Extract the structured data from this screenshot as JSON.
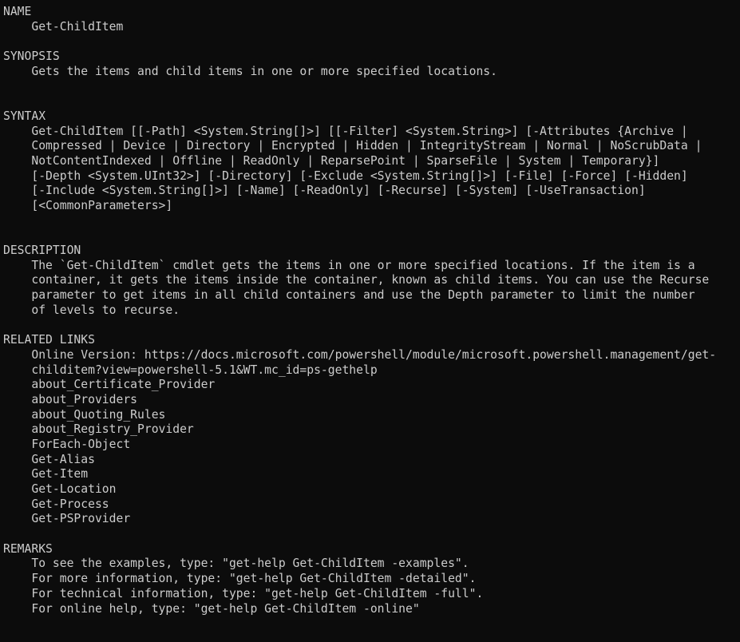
{
  "terminal": {
    "app": "powershell-help-output",
    "background_color": "#0c0c0c",
    "foreground_color": "#cccccc",
    "command_context": "Get-Help Get-ChildItem",
    "lines": [
      "NAME",
      "    Get-ChildItem",
      "",
      "SYNOPSIS",
      "    Gets the items and child items in one or more specified locations.",
      "",
      "",
      "SYNTAX",
      "    Get-ChildItem [[-Path] <System.String[]>] [[-Filter] <System.String>] [-Attributes {Archive |",
      "    Compressed | Device | Directory | Encrypted | Hidden | IntegrityStream | Normal | NoScrubData |",
      "    NotContentIndexed | Offline | ReadOnly | ReparsePoint | SparseFile | System | Temporary}]",
      "    [-Depth <System.UInt32>] [-Directory] [-Exclude <System.String[]>] [-File] [-Force] [-Hidden]",
      "    [-Include <System.String[]>] [-Name] [-ReadOnly] [-Recurse] [-System] [-UseTransaction]",
      "    [<CommonParameters>]",
      "",
      "",
      "DESCRIPTION",
      "    The `Get-ChildItem` cmdlet gets the items in one or more specified locations. If the item is a",
      "    container, it gets the items inside the container, known as child items. You can use the Recurse",
      "    parameter to get items in all child containers and use the Depth parameter to limit the number",
      "    of levels to recurse.",
      "",
      "RELATED LINKS",
      "    Online Version: https://docs.microsoft.com/powershell/module/microsoft.powershell.management/get-",
      "    childitem?view=powershell-5.1&WT.mc_id=ps-gethelp",
      "    about_Certificate_Provider",
      "    about_Providers",
      "    about_Quoting_Rules",
      "    about_Registry_Provider",
      "    ForEach-Object",
      "    Get-Alias",
      "    Get-Item",
      "    Get-Location",
      "    Get-Process",
      "    Get-PSProvider",
      "",
      "REMARKS",
      "    To see the examples, type: \"get-help Get-ChildItem -examples\".",
      "    For more information, type: \"get-help Get-ChildItem -detailed\".",
      "    For technical information, type: \"get-help Get-ChildItem -full\".",
      "    For online help, type: \"get-help Get-ChildItem -online\""
    ],
    "sections": {
      "name": "NAME",
      "synopsis": "SYNOPSIS",
      "syntax": "SYNTAX",
      "description": "DESCRIPTION",
      "related_links": "RELATED LINKS",
      "remarks": "REMARKS"
    },
    "cmdlet_name": "Get-ChildItem",
    "synopsis_text": "Gets the items and child items in one or more specified locations.",
    "online_version_url": "https://docs.microsoft.com/powershell/module/microsoft.powershell.management/get-childitem?view=powershell-5.1&WT.mc_id=ps-gethelp",
    "related_links_list": [
      "about_Certificate_Provider",
      "about_Providers",
      "about_Quoting_Rules",
      "about_Registry_Provider",
      "ForEach-Object",
      "Get-Alias",
      "Get-Item",
      "Get-Location",
      "Get-Process",
      "Get-PSProvider"
    ],
    "remarks_list": [
      "To see the examples, type: \"get-help Get-ChildItem -examples\".",
      "For more information, type: \"get-help Get-ChildItem -detailed\".",
      "For technical information, type: \"get-help Get-ChildItem -full\".",
      "For online help, type: \"get-help Get-ChildItem -online\""
    ]
  }
}
